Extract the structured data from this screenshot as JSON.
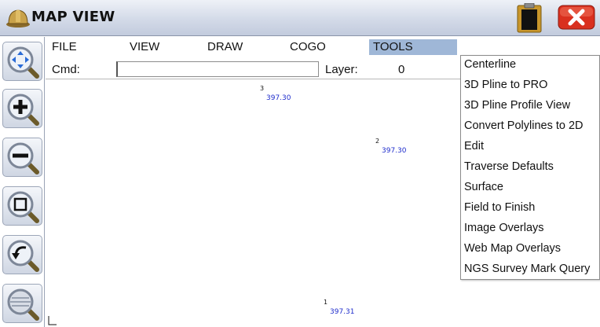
{
  "window": {
    "title": "MAP VIEW"
  },
  "menubar": {
    "items": [
      "FILE",
      "VIEW",
      "DRAW",
      "COGO",
      "TOOLS"
    ],
    "active": "TOOLS"
  },
  "command": {
    "label": "Cmd:",
    "value": "",
    "layer_label": "Layer:",
    "layer_value": "0"
  },
  "tools_menu": {
    "items": [
      "Centerline",
      "3D Pline to PRO",
      "3D Pline Profile View",
      "Convert Polylines to 2D",
      "Edit",
      "Traverse Defaults",
      "Surface",
      "Field to Finish",
      "Image Overlays",
      "Web Map Overlays",
      "NGS Survey Mark Query"
    ]
  },
  "map_points": [
    {
      "number": "3",
      "elevation": "397.30"
    },
    {
      "number": "2",
      "elevation": "397.30"
    },
    {
      "number": "1",
      "elevation": "397.31"
    }
  ],
  "toolbar": {
    "icons": [
      "zoom-pan-icon",
      "zoom-in-icon",
      "zoom-out-icon",
      "zoom-window-icon",
      "zoom-previous-icon",
      "zoom-extents-icon"
    ]
  },
  "colors": {
    "elevation_text": "#1f2dcc",
    "menu_highlight": "#9fb7d7",
    "close_button": "#d9301f"
  }
}
